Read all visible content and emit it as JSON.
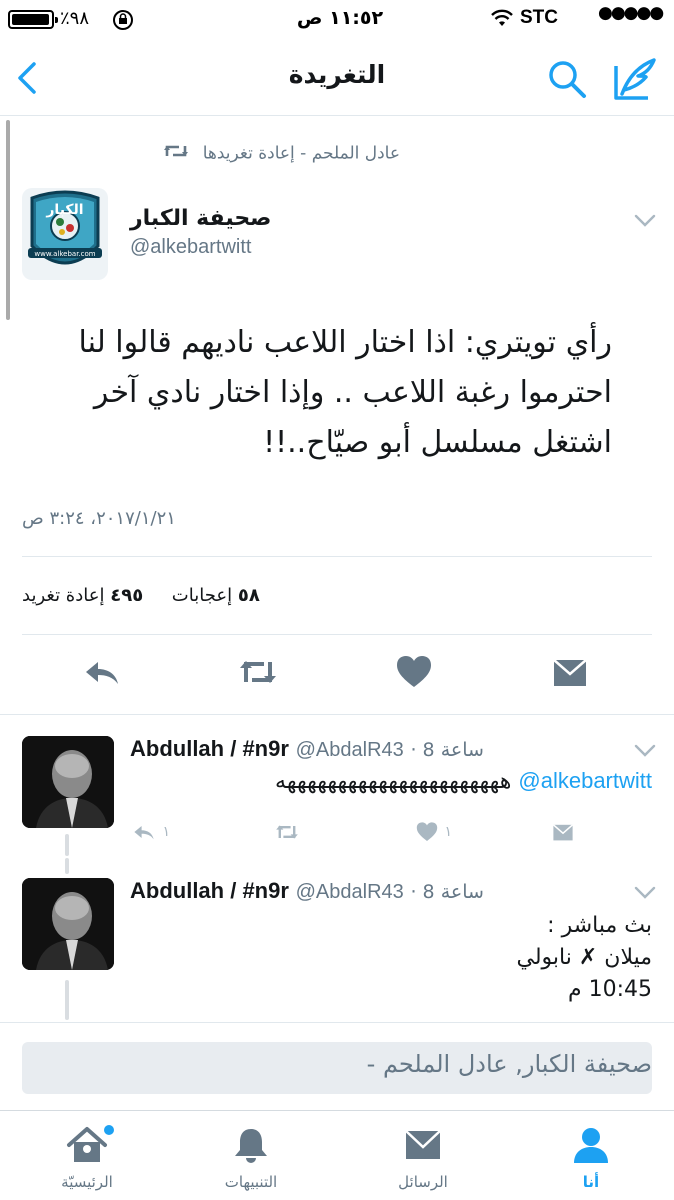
{
  "status_bar": {
    "carrier": "STC",
    "signal_dots": "●●●●●",
    "time": "١١:٥٢ ص",
    "battery_percent": "٪٩٨"
  },
  "nav": {
    "title": "التغريدة",
    "back_icon": "chevron-left-icon",
    "search_icon": "search-icon",
    "compose_icon": "compose-icon"
  },
  "tweet": {
    "retweet_context": "عادل الملحم - إعادة تغريدها",
    "author_name": "صحيفة الكبار",
    "author_handle": "@alkebartwitt",
    "avatar_site": "www.alkebar.com",
    "avatar_brand": "الكبار",
    "text_lines": [
      "رأي تويتري: اذا اختار اللاعب ناديهم قالوا لنا",
      "احترموا رغبة اللاعب .. وإذا اختار نادي آخر",
      "اشتغل مسلسل أبو صيّاح..!!"
    ],
    "timestamp": "٢٠١٧/١/٢١، ٣:٢٤ ص",
    "retweets_count": "٤٩٥",
    "retweets_label": "إعادة تغريد",
    "likes_count": "٥٨",
    "likes_label": "إعجابات"
  },
  "replies": [
    {
      "name": "Abdullah / #n9r",
      "handle": "@AbdalR43",
      "time": "8 ساعة",
      "mention": "@alkebartwitt",
      "text": "ههههههههههههههههههههههه",
      "reply_count": "١",
      "like_count": "١"
    },
    {
      "name": "Abdullah / #n9r",
      "handle": "@AbdalR43",
      "time": "8 ساعة",
      "text_lines": [
        "بث مباشر :",
        "ميلان ✗ نابولي",
        "10:45 م"
      ]
    }
  ],
  "composer": {
    "placeholder": "صحيفة الكبار, عادل الملحم -"
  },
  "tabbar": {
    "home": "الرئيسيّة",
    "notifications": "التنبيهات",
    "messages": "الرسائل",
    "me": "أنا"
  },
  "colors": {
    "accent": "#1da1f2",
    "muted": "#657786",
    "divider": "#e1e8ed"
  }
}
